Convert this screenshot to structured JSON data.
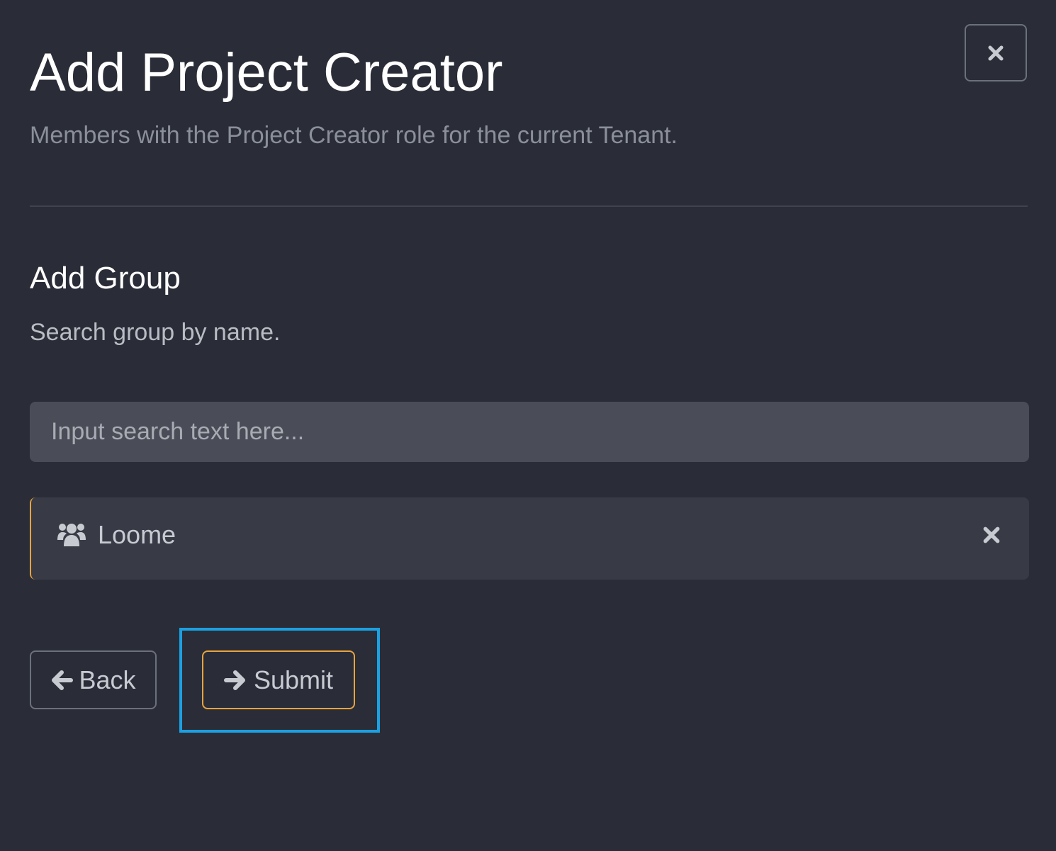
{
  "header": {
    "title": "Add Project Creator",
    "subtitle": "Members with the Project Creator role for the current Tenant.",
    "close_icon": "close-icon"
  },
  "section": {
    "title": "Add Group",
    "hint": "Search group by name."
  },
  "search": {
    "value": "",
    "placeholder": "Input search text here..."
  },
  "selected_group": {
    "icon": "users-icon",
    "name": "Loome",
    "remove_icon": "close-icon"
  },
  "actions": {
    "back_label": "Back",
    "back_icon": "arrow-left-icon",
    "submit_label": "Submit",
    "submit_icon": "arrow-right-icon",
    "focused": "submit"
  },
  "colors": {
    "background": "#2a2d37",
    "accent": "#e8a33d",
    "focus_ring": "#1ba1e2",
    "input_bg": "#4a4d57",
    "item_bg": "#383b46"
  }
}
